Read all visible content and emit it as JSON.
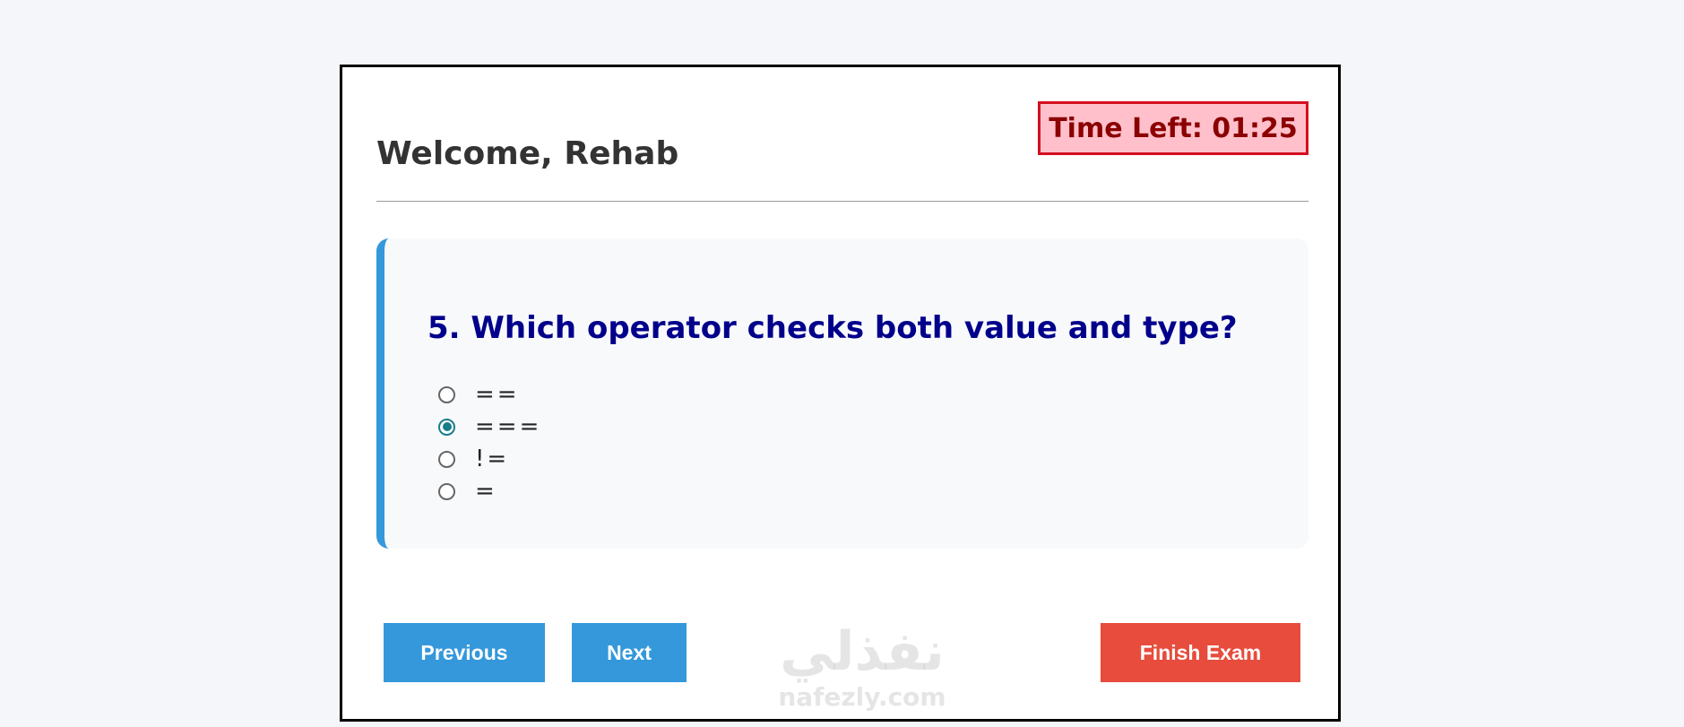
{
  "header": {
    "welcome": "Welcome, Rehab",
    "timer": "Time Left: 01:25"
  },
  "question": {
    "text": "5. Which operator checks both value and type?",
    "options": [
      {
        "label": "==",
        "selected": false
      },
      {
        "label": "===",
        "selected": true
      },
      {
        "label": "!=",
        "selected": false
      },
      {
        "label": "=",
        "selected": false
      }
    ]
  },
  "buttons": {
    "previous": "Previous",
    "next": "Next",
    "finish": "Finish Exam"
  },
  "watermark": {
    "arabic": "نفذلي",
    "latin": "nafezly.com"
  },
  "colors": {
    "primary": "#3498db",
    "danger": "#e74c3c",
    "question_text": "#00008b",
    "timer_text": "#8b0000",
    "timer_bg": "#ffc0cb",
    "radio_checked": "#177e89"
  }
}
